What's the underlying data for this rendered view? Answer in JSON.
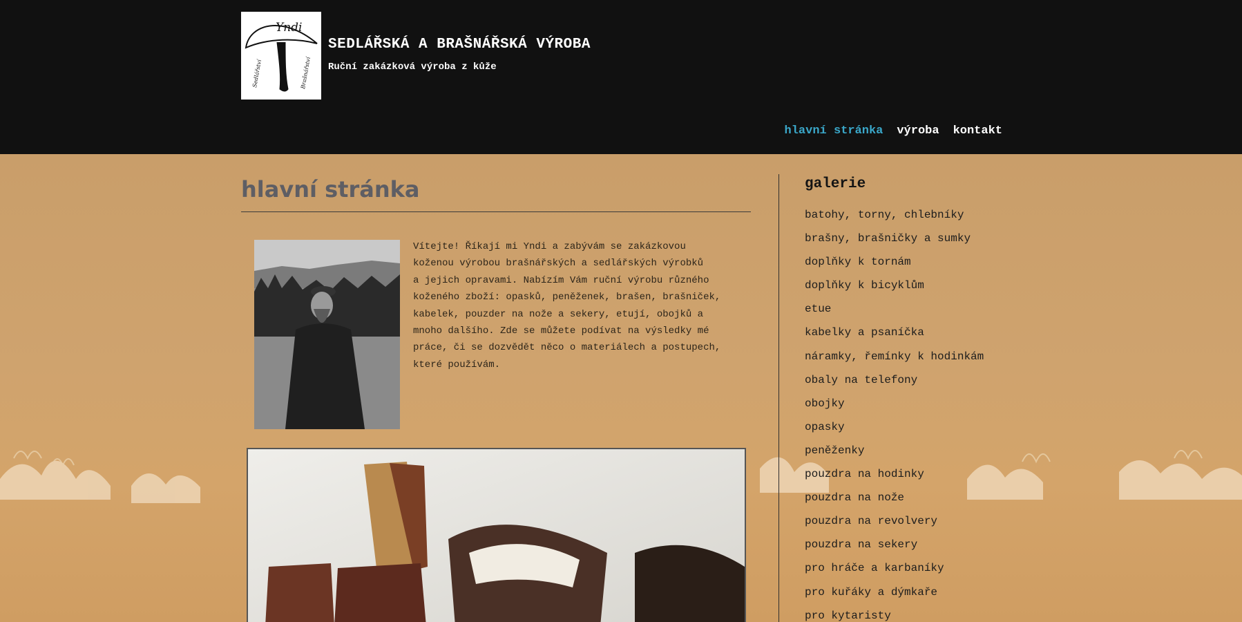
{
  "header": {
    "logo_text": "Yndi",
    "logo_side_left": "Sedlářství",
    "logo_side_right": "Brašnářství",
    "title": "SEDLÁŘSKÁ A BRAŠNÁŘSKÁ VÝROBA",
    "subtitle": "Ruční zakázková výroba z kůže"
  },
  "nav": {
    "items": [
      {
        "label": "hlavní stránka",
        "active": true
      },
      {
        "label": "výroba",
        "active": false
      },
      {
        "label": "kontakt",
        "active": false
      }
    ]
  },
  "main": {
    "heading": "hlavní stránka",
    "intro": "  Vítejte! Říkají mi Yndi a zabývám se zakázkovou\nkoženou výrobou brašnářských a sedlářských výrobků\na jejich opravami. Nabízím Vám ruční výrobu různého\nkoženého zboží: opasků, peněženek, brašen, brašniček,\nkabelek, pouzder na nože a sekery, etují, obojků a\nmnoho dalšího. Zde se můžete podívat na výsledky mé\npráce, či se dozvědět něco o materiálech a postupech,\nkteré používám."
  },
  "sidebar": {
    "title": "galerie",
    "items": [
      "batohy, torny, chlebníky",
      "brašny, brašničky a sumky",
      "doplňky k tornám",
      "doplňky k bicyklům",
      "etue",
      "kabelky a psaníčka",
      "náramky, řemínky k hodinkám",
      "obaly na telefony",
      "obojky",
      "opasky",
      "peněženky",
      "pouzdra na hodinky",
      "pouzdra na nože",
      "pouzdra na revolvery",
      "pouzdra na sekery",
      "pro hráče a karbaníky",
      "pro kuřáky a dýmkaře",
      "pro kytaristy"
    ]
  },
  "colors": {
    "header_bg": "#111111",
    "nav_active": "#3aa7c9",
    "page_bg": "#c89c67",
    "heading_text": "#5e5e64"
  }
}
